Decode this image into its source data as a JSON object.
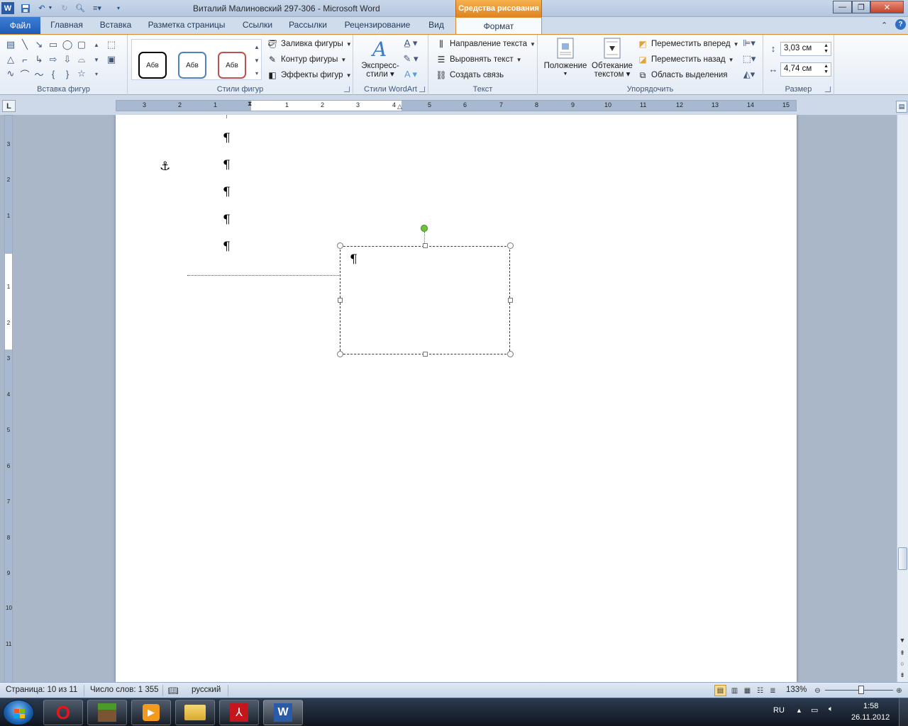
{
  "window": {
    "title": "Виталий Малиновский 297-306  -  Microsoft Word",
    "context_tab": "Средства рисования"
  },
  "tabs": {
    "file": "Файл",
    "items": [
      "Главная",
      "Вставка",
      "Разметка страницы",
      "Ссылки",
      "Рассылки",
      "Рецензирование",
      "Вид"
    ],
    "active": "Формат"
  },
  "ribbon": {
    "insert_shapes": {
      "label": "Вставка фигур"
    },
    "shape_styles": {
      "label": "Стили фигур",
      "thumbs": [
        "Абв",
        "Абв",
        "Абв"
      ],
      "thumb_colors": [
        "#000000",
        "#4f81bd",
        "#c0504d"
      ],
      "fill": "Заливка фигуры",
      "outline": "Контур фигуры",
      "effects": "Эффекты фигур"
    },
    "wordart": {
      "label": "Стили WordArt",
      "express_line1": "Экспресс-",
      "express_line2": "стили"
    },
    "text": {
      "label": "Текст",
      "direction": "Направление текста",
      "align": "Выровнять текст",
      "link": "Создать связь"
    },
    "arrange": {
      "label": "Упорядочить",
      "position": "Положение",
      "wrap_line1": "Обтекание",
      "wrap_line2": "текстом",
      "forward": "Переместить вперед",
      "backward": "Переместить назад",
      "selection": "Область выделения"
    },
    "size": {
      "label": "Размер",
      "height": "3,03 см",
      "width": "4,74 см"
    }
  },
  "ruler": {
    "h_numbers": [
      "3",
      "2",
      "1",
      "1",
      "2",
      "3",
      "4",
      "5",
      "6",
      "7",
      "8",
      "9",
      "10",
      "11",
      "12",
      "13",
      "14",
      "15"
    ],
    "v_numbers": [
      "3",
      "2",
      "1",
      "1",
      "2",
      "3",
      "4",
      "5",
      "6",
      "7",
      "8",
      "9",
      "10",
      "11"
    ]
  },
  "document": {
    "pilcrow": "¶",
    "anchor": "⚓"
  },
  "statusbar": {
    "page": "Страница: 10 из 11",
    "words": "Число слов: 1 355",
    "language": "русский",
    "zoom": "133%"
  },
  "taskbar": {
    "lang": "RU",
    "time": "1:58",
    "date": "26.11.2012"
  }
}
